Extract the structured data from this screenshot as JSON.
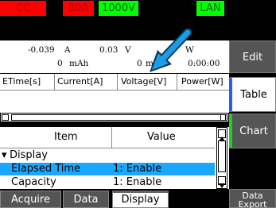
{
  "status": {
    "cc": "CC",
    "current_range": "80A",
    "voltage_range": "1000V",
    "lan": "LAN"
  },
  "readout": {
    "current": "-0.039",
    "current_unit": "A",
    "voltage": "0.03",
    "voltage_unit": "V",
    "power_unit": "W",
    "capacity": "0",
    "capacity_unit": "mAh",
    "energy": "0",
    "energy_unit": "mWh",
    "time": "0:00:00"
  },
  "table_header": [
    "ETime[s]",
    "Current[A]",
    "Voltage[V]",
    "Power[W]"
  ],
  "settings_list": {
    "col_item": "Item",
    "col_value": "Value",
    "group": "Display",
    "rows": [
      {
        "item": "Elapsed Time",
        "value": "1: Enable",
        "selected": true
      },
      {
        "item": "Capacity",
        "value": "1: Enable",
        "selected": false
      }
    ]
  },
  "side_buttons": {
    "edit": "Edit",
    "table": "Table",
    "chart": "Chart",
    "data_export_1": "Data",
    "data_export_2": "Export"
  },
  "tabs": {
    "acquire": "Acquire",
    "data": "Data",
    "display": "Display"
  },
  "colors": {
    "accent_blue": "#19a7ff",
    "table_indicator": "#3355ff",
    "chart_indicator": "#22cc22",
    "arrow": "#1a9fe6"
  }
}
